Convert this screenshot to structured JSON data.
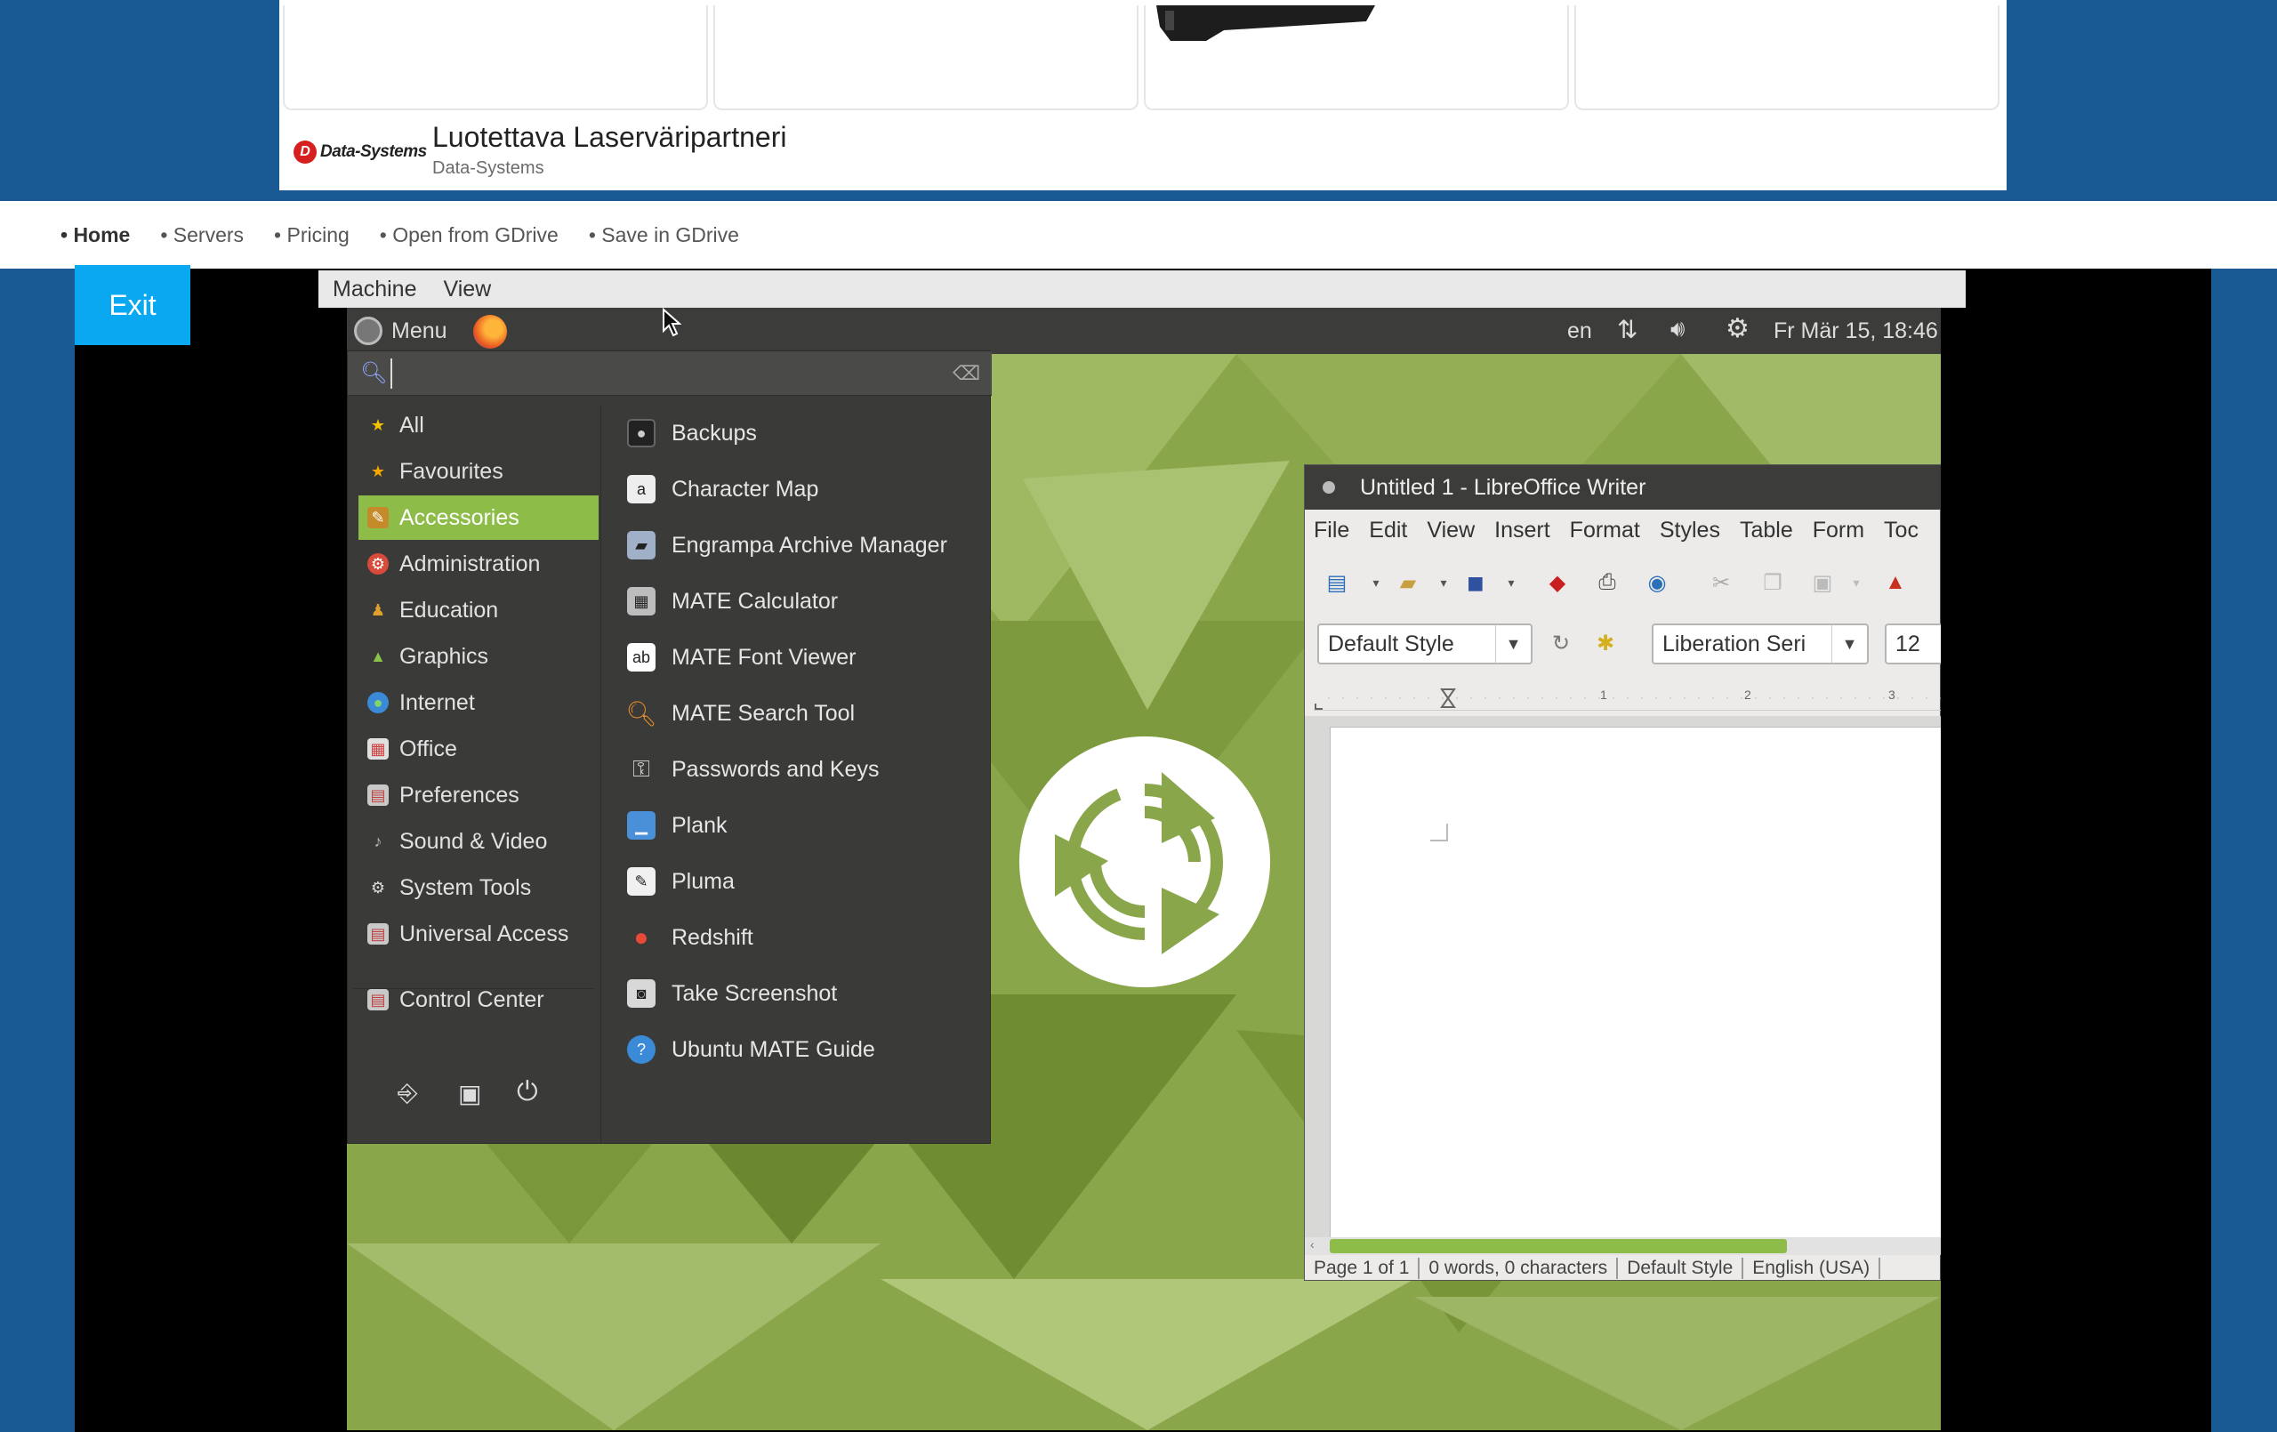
{
  "ad": {
    "title": "Luotettava Laserväripartneri",
    "advertiser": "Data-Systems",
    "logo_text": "Data-Systems"
  },
  "nav": {
    "items": [
      {
        "label": "• Home",
        "active": true
      },
      {
        "label": "• Servers",
        "active": false
      },
      {
        "label": "• Pricing",
        "active": false
      },
      {
        "label": "• Open from GDrive",
        "active": false
      },
      {
        "label": "• Save in GDrive",
        "active": false
      }
    ]
  },
  "exit_label": "Exit",
  "vm_menu": [
    "Machine",
    "View"
  ],
  "panel": {
    "menu_label": "Menu",
    "keyboard_layout": "en",
    "datetime": "Fr Mär 15, 18:46"
  },
  "mate_menu": {
    "search_value": "",
    "categories": [
      {
        "label": "All",
        "icon": "star-icon",
        "selected": false
      },
      {
        "label": "Favourites",
        "icon": "star-icon",
        "selected": false
      },
      {
        "label": "Accessories",
        "icon": "accessories-icon",
        "selected": true
      },
      {
        "label": "Administration",
        "icon": "administration-icon",
        "selected": false
      },
      {
        "label": "Education",
        "icon": "education-icon",
        "selected": false
      },
      {
        "label": "Graphics",
        "icon": "graphics-icon",
        "selected": false
      },
      {
        "label": "Internet",
        "icon": "globe-icon",
        "selected": false
      },
      {
        "label": "Office",
        "icon": "office-icon",
        "selected": false
      },
      {
        "label": "Preferences",
        "icon": "preferences-icon",
        "selected": false
      },
      {
        "label": "Sound & Video",
        "icon": "sound-video-icon",
        "selected": false
      },
      {
        "label": "System Tools",
        "icon": "gear-icon",
        "selected": false
      },
      {
        "label": "Universal Access",
        "icon": "universal-access-icon",
        "selected": false
      },
      {
        "label": "Control Center",
        "icon": "control-center-icon",
        "selected": false
      }
    ],
    "apps": [
      {
        "label": "Backups",
        "icon": "backups-icon"
      },
      {
        "label": "Character Map",
        "icon": "character-map-icon"
      },
      {
        "label": "Engrampa Archive Manager",
        "icon": "archive-icon"
      },
      {
        "label": "MATE Calculator",
        "icon": "calculator-icon"
      },
      {
        "label": "MATE Font Viewer",
        "icon": "font-viewer-icon"
      },
      {
        "label": "MATE Search Tool",
        "icon": "search-tool-icon"
      },
      {
        "label": "Passwords and Keys",
        "icon": "keys-icon"
      },
      {
        "label": "Plank",
        "icon": "plank-icon"
      },
      {
        "label": "Pluma",
        "icon": "pluma-icon"
      },
      {
        "label": "Redshift",
        "icon": "redshift-icon"
      },
      {
        "label": "Take Screenshot",
        "icon": "camera-icon"
      },
      {
        "label": "Ubuntu MATE Guide",
        "icon": "help-icon"
      }
    ]
  },
  "writer": {
    "title": "Untitled 1 - LibreOffice Writer",
    "menu": [
      "File",
      "Edit",
      "View",
      "Insert",
      "Format",
      "Styles",
      "Table",
      "Form",
      "Toc"
    ],
    "paragraph_style": "Default Style",
    "font_name": "Liberation Seri",
    "font_size": "12",
    "ruler_marks": [
      "1",
      "2",
      "3"
    ],
    "status": {
      "page": "Page 1 of 1",
      "words": "0 words, 0 characters",
      "style": "Default Style",
      "language": "English (USA)"
    }
  },
  "colors": {
    "site_blue": "#1a5a94",
    "exit_blue": "#0aa8f0",
    "mate_green": "#8dbd48",
    "panel_dark": "#3c3c3a"
  }
}
